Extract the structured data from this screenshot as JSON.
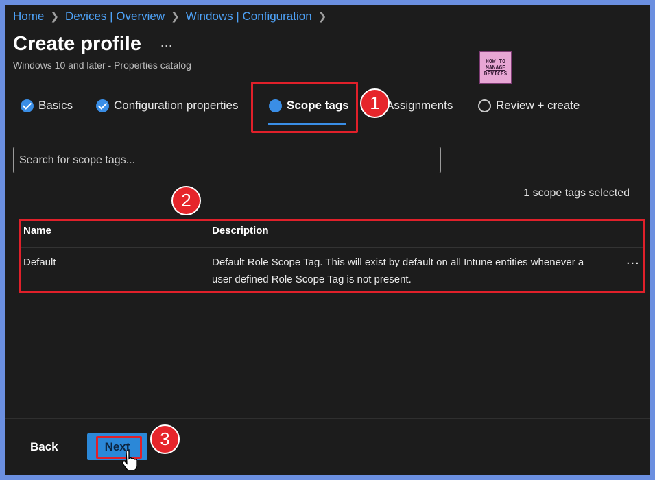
{
  "breadcrumb": [
    "Home",
    "Devices | Overview",
    "Windows | Configuration"
  ],
  "page": {
    "title": "Create profile",
    "more": "...",
    "subtitle": "Windows 10 and later - Properties catalog"
  },
  "logo": {
    "line1": "HOW TO",
    "line2": "MANAGE",
    "line3": "DEVICES"
  },
  "tabs": [
    {
      "label": "Basics",
      "state": "complete"
    },
    {
      "label": "Configuration properties",
      "state": "complete"
    },
    {
      "label": "Scope tags",
      "state": "active"
    },
    {
      "label": "Assignments",
      "state": "pending"
    },
    {
      "label": "Review + create",
      "state": "pending"
    }
  ],
  "search": {
    "placeholder": "Search for scope tags..."
  },
  "selected_count": "1 scope tags selected",
  "table": {
    "headers": {
      "name": "Name",
      "description": "Description"
    },
    "rows": [
      {
        "name": "Default",
        "description_line1": "Default Role Scope Tag. This will exist by default on all Intune entities whenever a",
        "description_line2": "user defined Role Scope Tag is not present.",
        "more": "..."
      }
    ]
  },
  "footer": {
    "back_label": "Back",
    "next_label": "Next"
  },
  "annotations": {
    "step1": "1",
    "step2": "2",
    "step3": "3"
  },
  "colors": {
    "accent": "#2b88d8",
    "highlight": "#e0202a",
    "background": "#1c1c1c",
    "link": "#4ea2f7"
  }
}
